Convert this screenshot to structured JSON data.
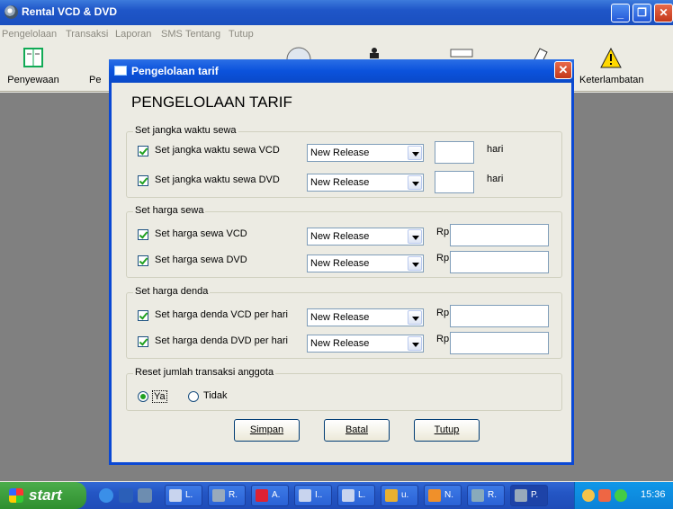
{
  "app": {
    "title": "Rental VCD & DVD"
  },
  "menu": [
    "Pengelolaan",
    "Transaksi",
    "Laporan",
    "SMS",
    "Tentang",
    "Tutup"
  ],
  "toolbar": {
    "left_label": "Penyewaan",
    "left_partial": "Pe",
    "right_label": "Keterlambatan"
  },
  "dialog": {
    "title": "Pengelolaan tarif",
    "heading": "PENGELOLAAN TARIF",
    "groups": {
      "jangka": {
        "label": "Set jangka waktu sewa",
        "rows": [
          {
            "label": "Set jangka waktu sewa VCD",
            "selected": "New Release",
            "unit": "hari",
            "value": ""
          },
          {
            "label": "Set jangka waktu sewa DVD",
            "selected": "New Release",
            "unit": "hari",
            "value": ""
          }
        ]
      },
      "harga": {
        "label": "Set harga sewa",
        "rows": [
          {
            "label": "Set harga sewa VCD",
            "selected": "New Release",
            "prefix": "Rp",
            "value": ""
          },
          {
            "label": "Set harga sewa DVD",
            "selected": "New Release",
            "prefix": "Rp",
            "value": ""
          }
        ]
      },
      "denda": {
        "label": "Set harga denda",
        "rows": [
          {
            "label": "Set harga denda VCD per hari",
            "selected": "New Release",
            "prefix": "Rp",
            "value": ""
          },
          {
            "label": "Set harga denda DVD per hari",
            "selected": "New Release",
            "prefix": "Rp",
            "value": ""
          }
        ]
      },
      "reset": {
        "label": "Reset jumlah transaksi anggota",
        "yes": "Ya",
        "no": "Tidak",
        "selected": "Ya"
      }
    },
    "buttons": {
      "save": "Simpan",
      "cancel": "Batal",
      "close": "Tutup"
    }
  },
  "taskbar": {
    "start": "start",
    "tasks": [
      "L.",
      "R.",
      "A.",
      "I..",
      "L.",
      "u.",
      "N.",
      "R.",
      "P."
    ],
    "clock": "15:36"
  },
  "colors": {
    "titlebar": "#1f56c8",
    "close": "#c3381a",
    "start": "#2f8f2f",
    "check": "#21a121"
  }
}
